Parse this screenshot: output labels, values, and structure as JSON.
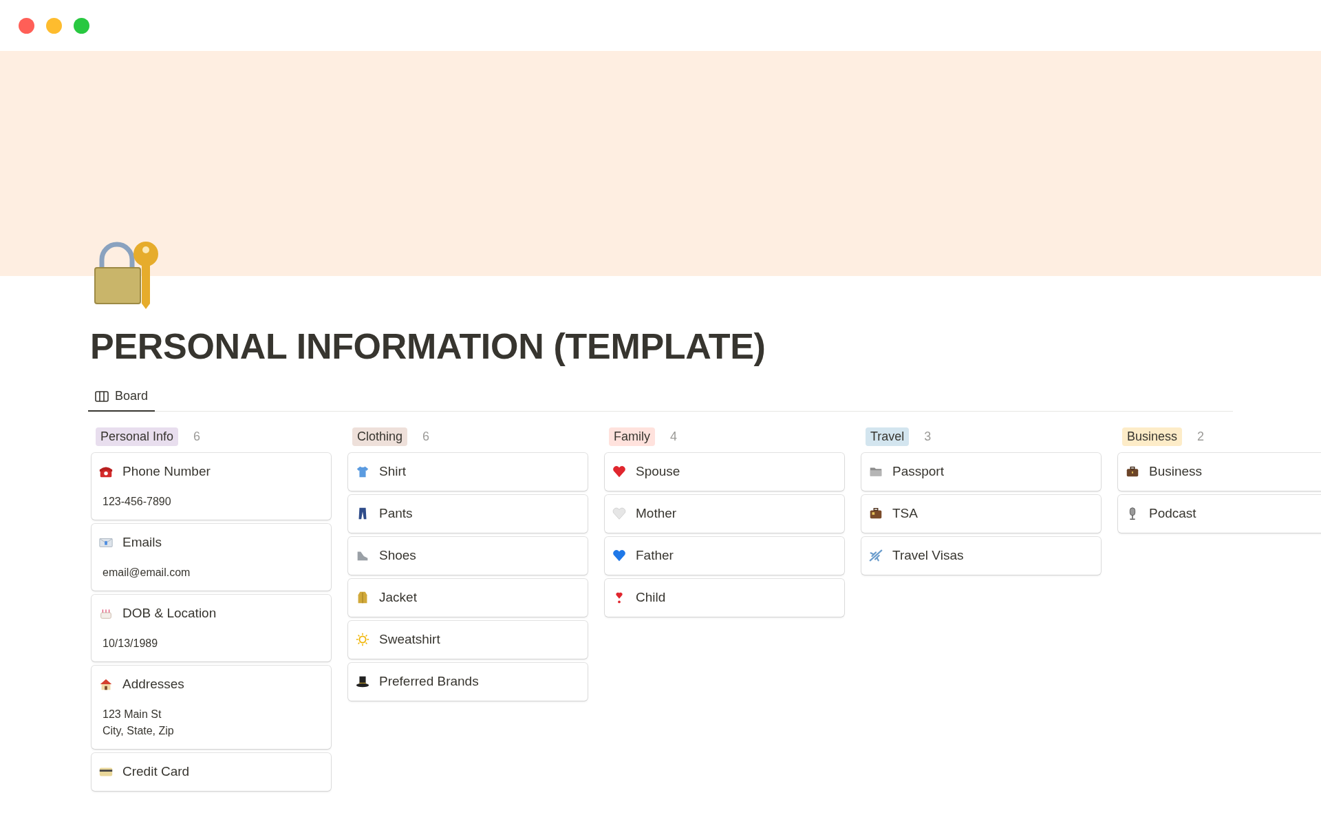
{
  "page": {
    "title": "PERSONAL INFORMATION (TEMPLATE)"
  },
  "views": [
    {
      "label": "Board",
      "selected": true
    }
  ],
  "board": {
    "columns": [
      {
        "tag": "Personal Info",
        "color": "#e8deee",
        "count": "6",
        "cards": [
          {
            "title": "Phone Number",
            "lines": [
              "123-456-7890"
            ]
          },
          {
            "title": "Emails",
            "lines": [
              "email@email.com"
            ]
          },
          {
            "title": "DOB & Location",
            "lines": [
              "10/13/1989"
            ]
          },
          {
            "title": "Addresses",
            "lines": [
              "123 Main St",
              "City, State, Zip"
            ]
          },
          {
            "title": "Credit Card"
          }
        ]
      },
      {
        "tag": "Clothing",
        "color": "#eee0da",
        "count": "6",
        "cards": [
          {
            "title": "Shirt"
          },
          {
            "title": "Pants"
          },
          {
            "title": "Shoes"
          },
          {
            "title": "Jacket"
          },
          {
            "title": "Sweatshirt"
          },
          {
            "title": "Preferred Brands"
          }
        ]
      },
      {
        "tag": "Family",
        "color": "#ffe2dd",
        "count": "4",
        "cards": [
          {
            "title": "Spouse"
          },
          {
            "title": "Mother"
          },
          {
            "title": "Father"
          },
          {
            "title": "Child"
          }
        ]
      },
      {
        "tag": "Travel",
        "color": "#d3e5ef",
        "count": "3",
        "cards": [
          {
            "title": "Passport"
          },
          {
            "title": "TSA"
          },
          {
            "title": "Travel Visas"
          }
        ]
      },
      {
        "tag": "Business",
        "color": "#fdecc8",
        "count": "2",
        "cards": [
          {
            "title": "Business"
          },
          {
            "title": "Podcast"
          }
        ]
      }
    ]
  }
}
